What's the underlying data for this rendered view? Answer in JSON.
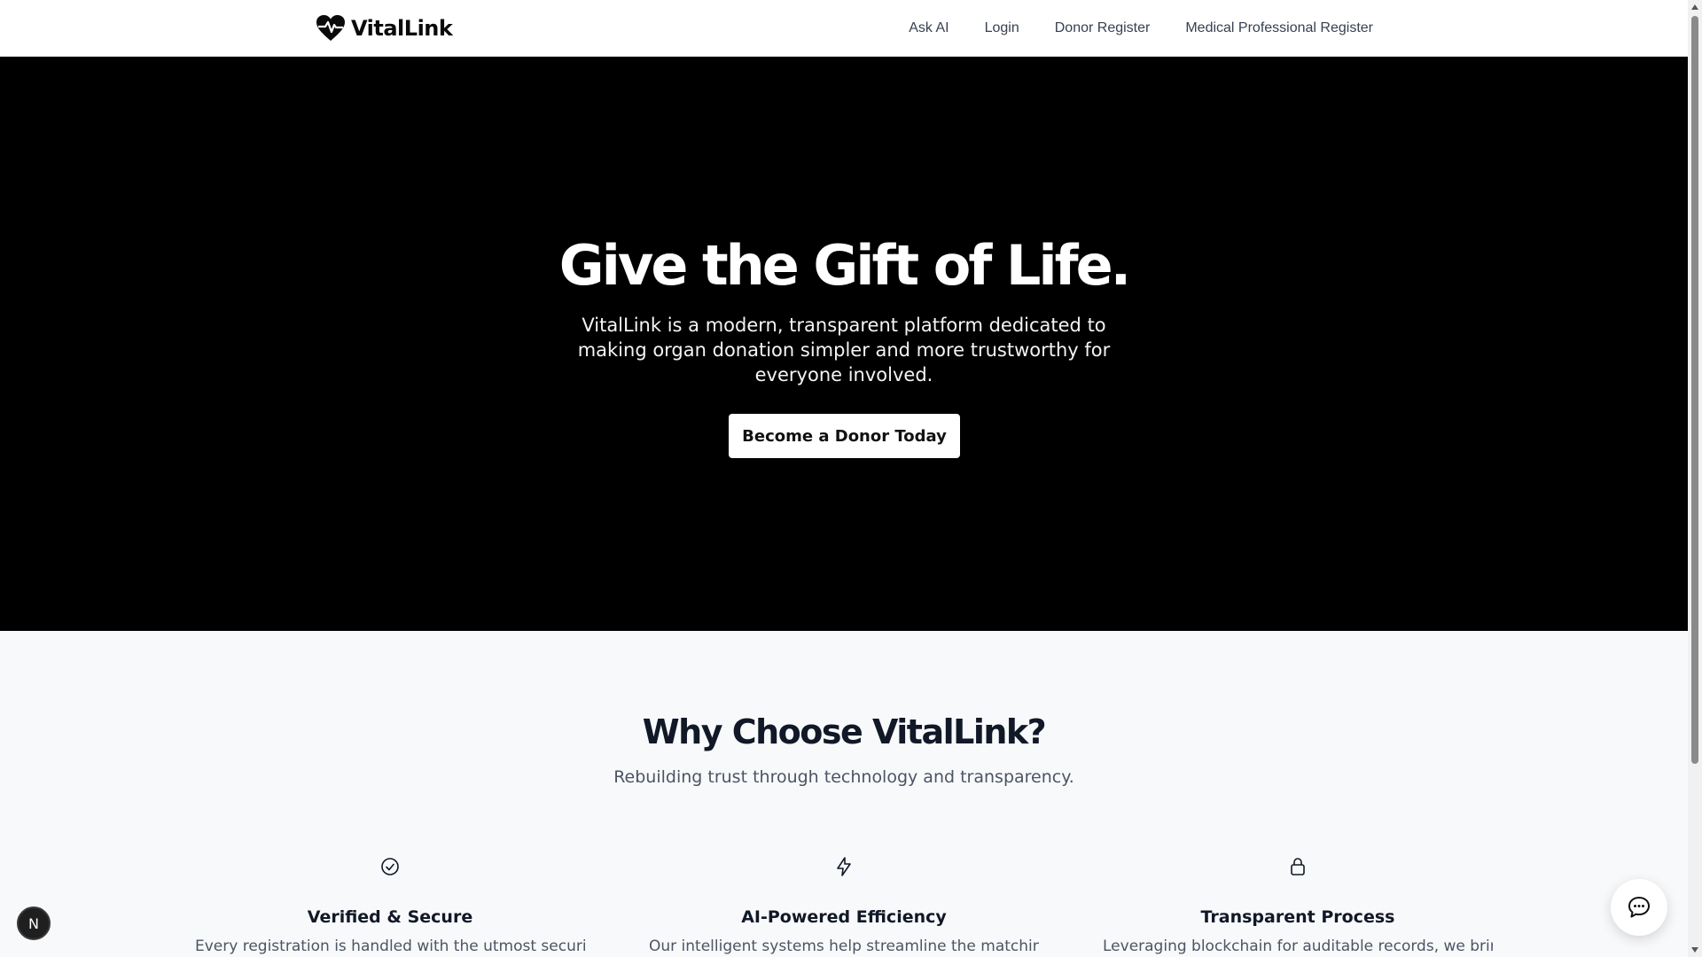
{
  "header": {
    "logo_text": "VitalLink",
    "nav": [
      "Ask AI",
      "Login",
      "Donor Register",
      "Medical Professional Register"
    ]
  },
  "hero": {
    "title": "Give the Gift of Life.",
    "subtitle": "VitalLink is a modern, transparent platform dedicated to making organ donation simpler and more trustworthy for everyone involved.",
    "cta": "Become a Donor Today"
  },
  "features": {
    "title": "Why Choose VitalLink?",
    "subtitle": "Rebuilding trust through technology and transparency.",
    "items": [
      {
        "icon": "check-circle-icon",
        "title": "Verified & Secure",
        "desc": "Every registration is handled with the utmost security,"
      },
      {
        "icon": "lightning-icon",
        "title": "AI-Powered Efficiency",
        "desc": "Our intelligent systems help streamline the matching"
      },
      {
        "icon": "lock-icon",
        "title": "Transparent Process",
        "desc": "Leveraging blockchain for auditable records, we bring"
      }
    ]
  },
  "dev_badge": {
    "label": "N"
  },
  "colors": {
    "hero_bg": "#000000",
    "page_bg": "#f8f9fb",
    "text_dark": "#111827",
    "text_muted": "#4b5563"
  }
}
